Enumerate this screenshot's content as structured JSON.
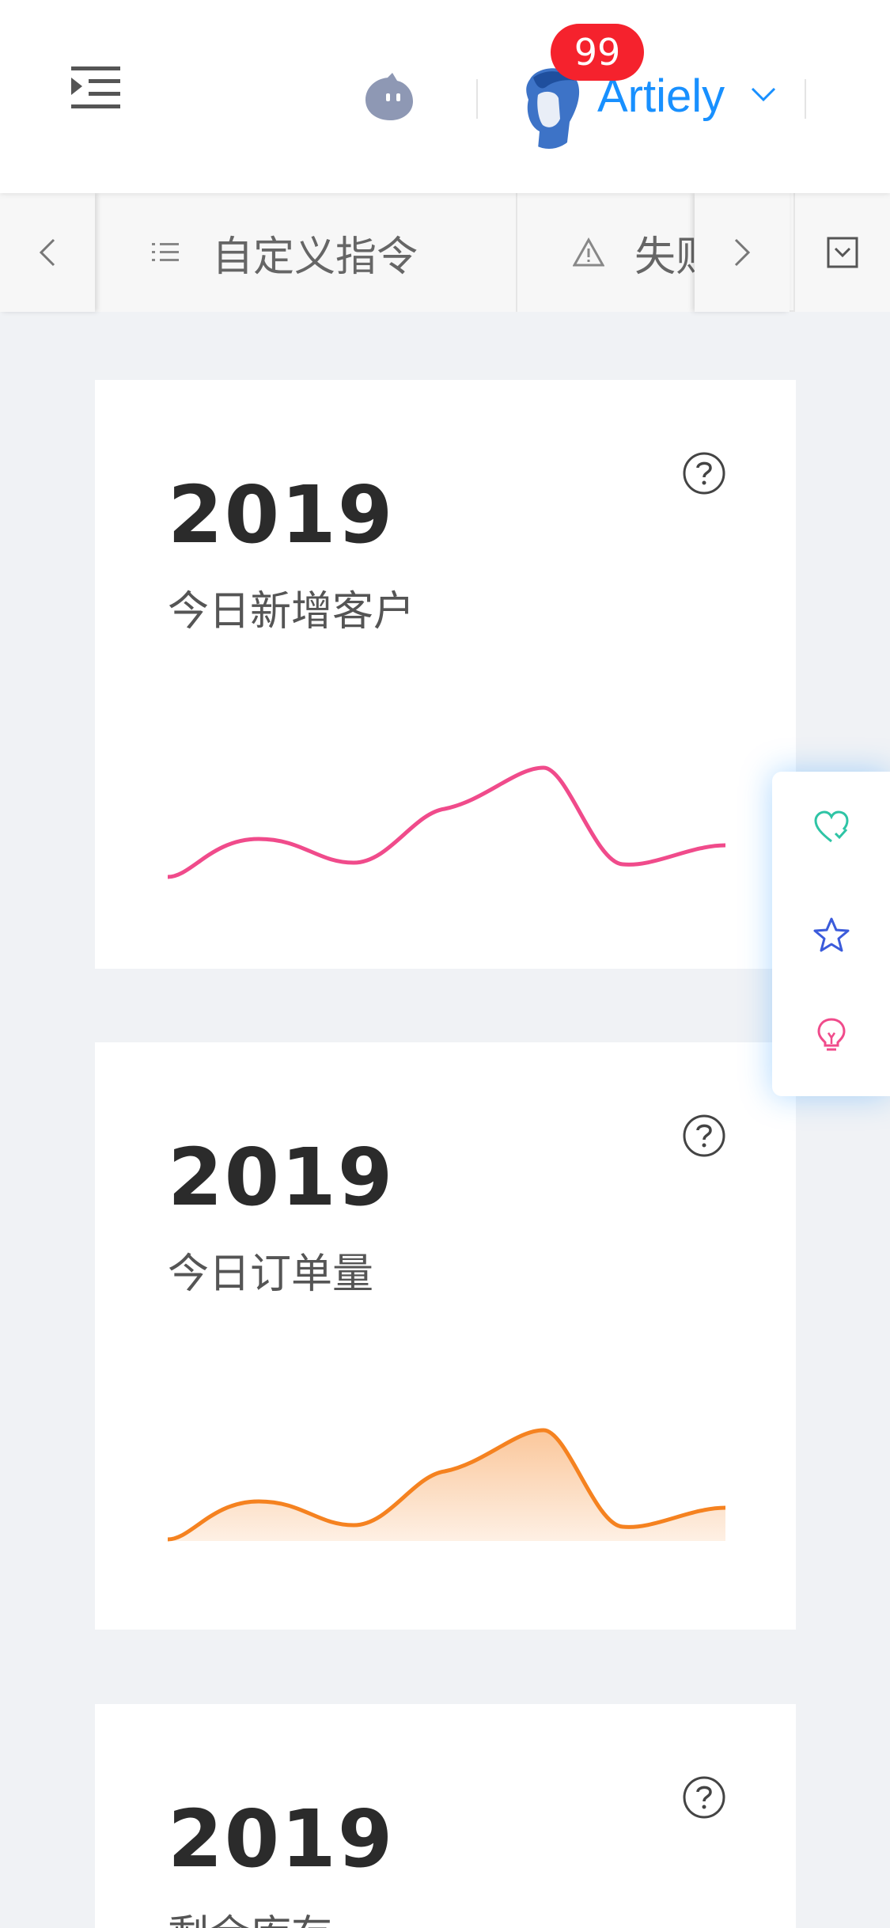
{
  "header": {
    "username": "Artiely",
    "notification_count": "99",
    "icons": [
      "menu-unfold-icon",
      "bot-icon",
      "avatar",
      "chevron-down-icon"
    ]
  },
  "tabs": {
    "items": [
      {
        "label": "自定义指令",
        "icon": "unordered-list-icon"
      },
      {
        "label": "失败",
        "icon": "warning-icon"
      }
    ],
    "nav_left_icon": "chevron-left-icon",
    "nav_right_icon": "chevron-right-icon",
    "dropdown_icon": "check-square-icon"
  },
  "cards": [
    {
      "value": "2019",
      "label": "今日新增客户",
      "chart_color": "#f04b8b",
      "filled": false
    },
    {
      "value": "2019",
      "label": "今日订单量",
      "chart_color": "#f58220",
      "filled": true
    },
    {
      "value": "2019",
      "label": "剩余库存"
    }
  ],
  "float_actions": [
    {
      "icon": "heart-icon",
      "color": "#2ec4a5"
    },
    {
      "icon": "star-icon",
      "color": "#3b5bdb"
    },
    {
      "icon": "bulb-icon",
      "color": "#f04b8b"
    }
  ]
}
